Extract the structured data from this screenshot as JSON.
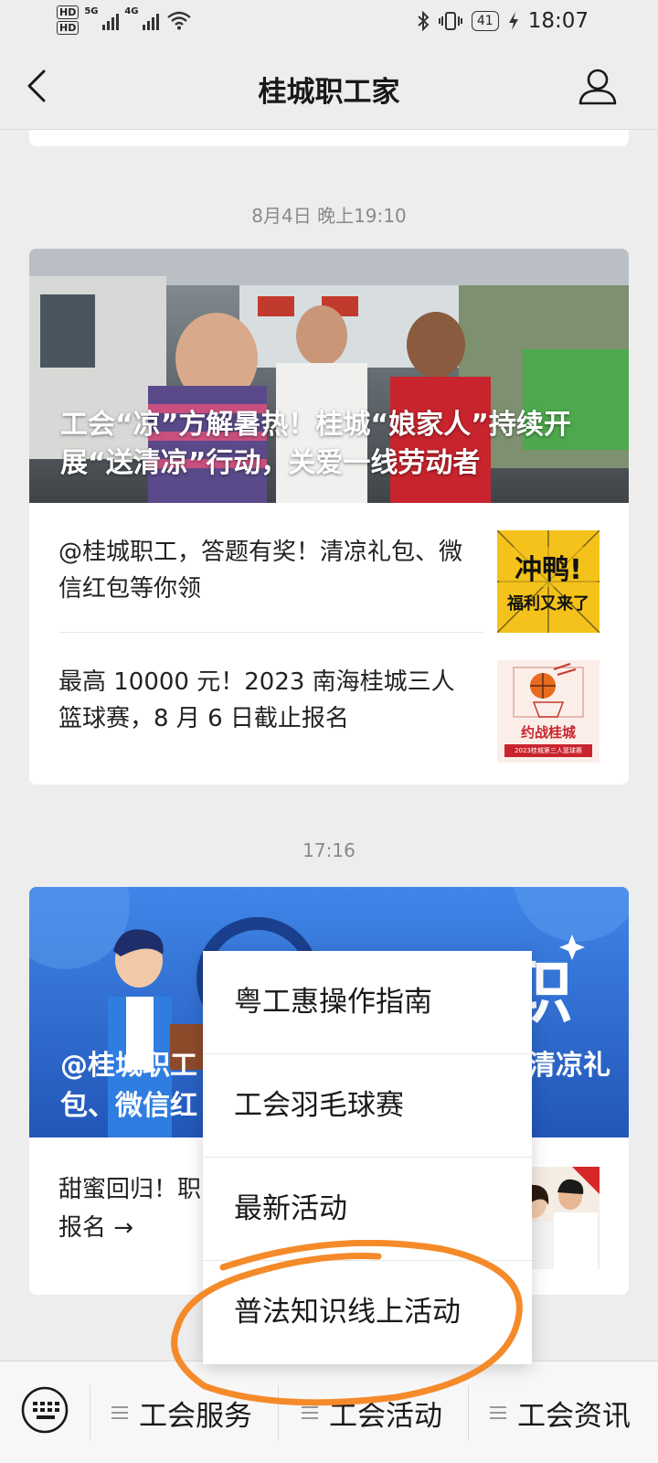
{
  "status_bar": {
    "hd1": "HD",
    "hd2": "HD",
    "net1": "5G",
    "net2": "4G",
    "battery": "41",
    "time": "18:07"
  },
  "nav": {
    "title": "桂城职工家",
    "back_icon": "chevron-left-icon",
    "profile_icon": "person-icon"
  },
  "messages": [
    {
      "time": "8月4日 晚上19:10",
      "cover_title": "工会“凉”方解暑热！桂城“娘家人”持续开展“送清凉”行动，关爱一线劳动者",
      "items": [
        {
          "text": "@桂城职工，答题有奖！清凉礼包、微信红包等你领",
          "thumb_line1": "冲鸭!",
          "thumb_line2": "福利又来了"
        },
        {
          "text": "最高 10000 元！2023 南海桂城三人篮球赛，8 月 6 日截止报名",
          "thumb_caption": "约战桂城",
          "thumb_sub": "2023桂城第三人篮球赛"
        }
      ]
    },
    {
      "time": "17:16",
      "cover_title_left": "@桂城职工",
      "cover_title_left2": "包、微信红",
      "cover_title_right": "清凉礼",
      "cover_big_char": "职",
      "items": [
        {
          "text_line1": "甜蜜回归！职",
          "text_line2": "报名 →"
        }
      ]
    }
  ],
  "popup_menu": {
    "items": [
      "粤工惠操作指南",
      "工会羽毛球赛",
      "最新活动",
      "普法知识线上活动"
    ]
  },
  "bottom_bar": {
    "keyboard_icon": "keyboard-icon",
    "tabs": [
      "工会服务",
      "工会活动",
      "工会资讯"
    ]
  },
  "colors": {
    "accent_highlight": "#f58a2a",
    "background": "#ededed",
    "card": "#ffffff",
    "blue_cover": "#2f6fd6"
  }
}
